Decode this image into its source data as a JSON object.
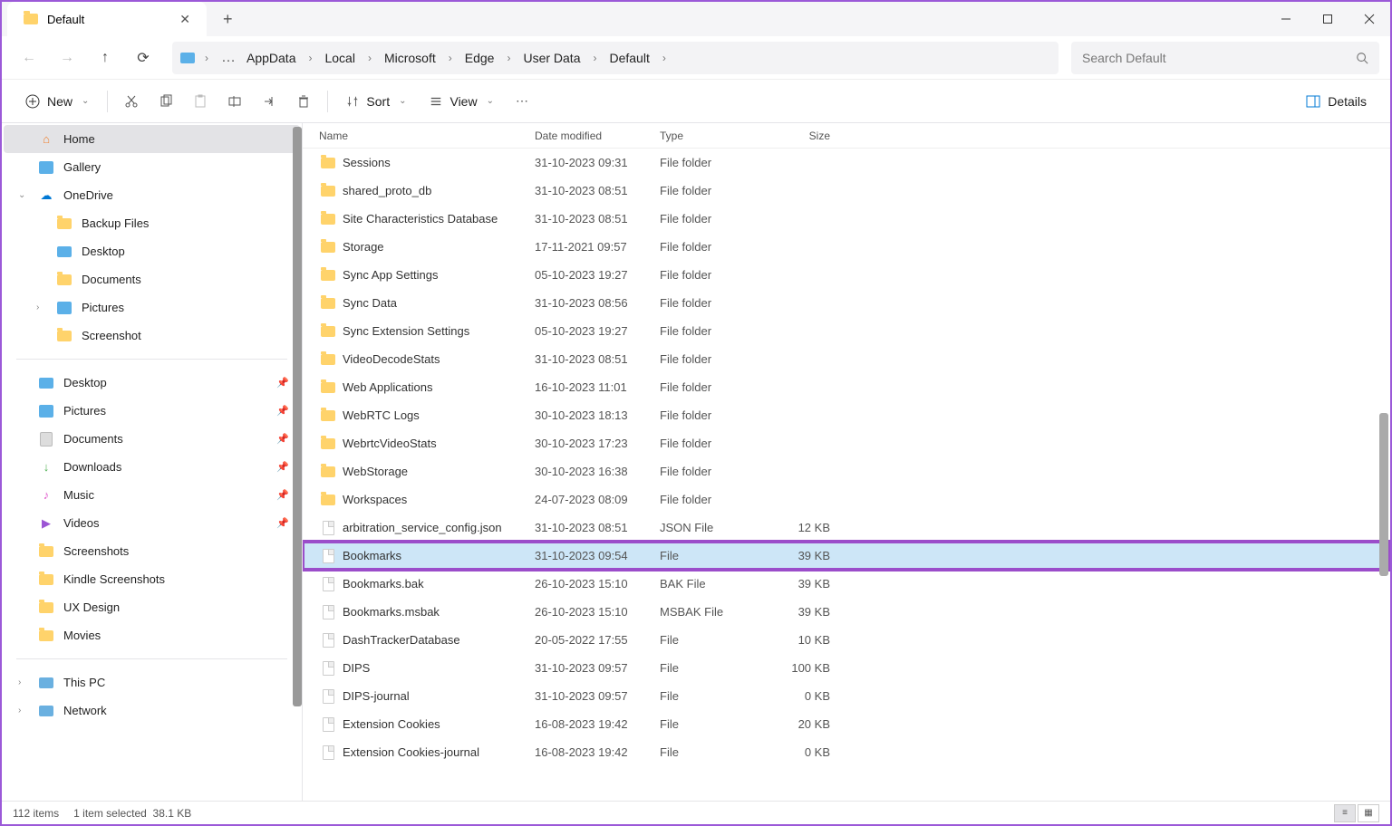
{
  "tab": {
    "title": "Default"
  },
  "breadcrumb": [
    "AppData",
    "Local",
    "Microsoft",
    "Edge",
    "User Data",
    "Default"
  ],
  "search": {
    "placeholder": "Search Default"
  },
  "toolbar": {
    "new": "New",
    "sort": "Sort",
    "view": "View",
    "details": "Details"
  },
  "sidebar": {
    "home": "Home",
    "gallery": "Gallery",
    "onedrive": "OneDrive",
    "backup_files": "Backup Files",
    "desktop": "Desktop",
    "documents": "Documents",
    "pictures": "Pictures",
    "screenshot": "Screenshot",
    "desktop2": "Desktop",
    "pictures2": "Pictures",
    "documents2": "Documents",
    "downloads": "Downloads",
    "music": "Music",
    "videos": "Videos",
    "screenshots": "Screenshots",
    "kindle": "Kindle Screenshots",
    "uxdesign": "UX Design",
    "movies": "Movies",
    "thispc": "This PC",
    "network": "Network"
  },
  "columns": {
    "name": "Name",
    "date": "Date modified",
    "type": "Type",
    "size": "Size"
  },
  "files": [
    {
      "name": "Sessions",
      "date": "31-10-2023 09:31",
      "type": "File folder",
      "size": "",
      "kind": "folder"
    },
    {
      "name": "shared_proto_db",
      "date": "31-10-2023 08:51",
      "type": "File folder",
      "size": "",
      "kind": "folder"
    },
    {
      "name": "Site Characteristics Database",
      "date": "31-10-2023 08:51",
      "type": "File folder",
      "size": "",
      "kind": "folder"
    },
    {
      "name": "Storage",
      "date": "17-11-2021 09:57",
      "type": "File folder",
      "size": "",
      "kind": "folder"
    },
    {
      "name": "Sync App Settings",
      "date": "05-10-2023 19:27",
      "type": "File folder",
      "size": "",
      "kind": "folder"
    },
    {
      "name": "Sync Data",
      "date": "31-10-2023 08:56",
      "type": "File folder",
      "size": "",
      "kind": "folder"
    },
    {
      "name": "Sync Extension Settings",
      "date": "05-10-2023 19:27",
      "type": "File folder",
      "size": "",
      "kind": "folder"
    },
    {
      "name": "VideoDecodeStats",
      "date": "31-10-2023 08:51",
      "type": "File folder",
      "size": "",
      "kind": "folder"
    },
    {
      "name": "Web Applications",
      "date": "16-10-2023 11:01",
      "type": "File folder",
      "size": "",
      "kind": "folder"
    },
    {
      "name": "WebRTC Logs",
      "date": "30-10-2023 18:13",
      "type": "File folder",
      "size": "",
      "kind": "folder"
    },
    {
      "name": "WebrtcVideoStats",
      "date": "30-10-2023 17:23",
      "type": "File folder",
      "size": "",
      "kind": "folder"
    },
    {
      "name": "WebStorage",
      "date": "30-10-2023 16:38",
      "type": "File folder",
      "size": "",
      "kind": "folder"
    },
    {
      "name": "Workspaces",
      "date": "24-07-2023 08:09",
      "type": "File folder",
      "size": "",
      "kind": "folder"
    },
    {
      "name": "arbitration_service_config.json",
      "date": "31-10-2023 08:51",
      "type": "JSON File",
      "size": "12 KB",
      "kind": "file"
    },
    {
      "name": "Bookmarks",
      "date": "31-10-2023 09:54",
      "type": "File",
      "size": "39 KB",
      "kind": "file",
      "selected": true,
      "highlighted": true
    },
    {
      "name": "Bookmarks.bak",
      "date": "26-10-2023 15:10",
      "type": "BAK File",
      "size": "39 KB",
      "kind": "file"
    },
    {
      "name": "Bookmarks.msbak",
      "date": "26-10-2023 15:10",
      "type": "MSBAK File",
      "size": "39 KB",
      "kind": "file"
    },
    {
      "name": "DashTrackerDatabase",
      "date": "20-05-2022 17:55",
      "type": "File",
      "size": "10 KB",
      "kind": "file"
    },
    {
      "name": "DIPS",
      "date": "31-10-2023 09:57",
      "type": "File",
      "size": "100 KB",
      "kind": "file"
    },
    {
      "name": "DIPS-journal",
      "date": "31-10-2023 09:57",
      "type": "File",
      "size": "0 KB",
      "kind": "file"
    },
    {
      "name": "Extension Cookies",
      "date": "16-08-2023 19:42",
      "type": "File",
      "size": "20 KB",
      "kind": "file"
    },
    {
      "name": "Extension Cookies-journal",
      "date": "16-08-2023 19:42",
      "type": "File",
      "size": "0 KB",
      "kind": "file"
    }
  ],
  "status": {
    "items": "112 items",
    "selected": "1 item selected",
    "size": "38.1 KB"
  }
}
